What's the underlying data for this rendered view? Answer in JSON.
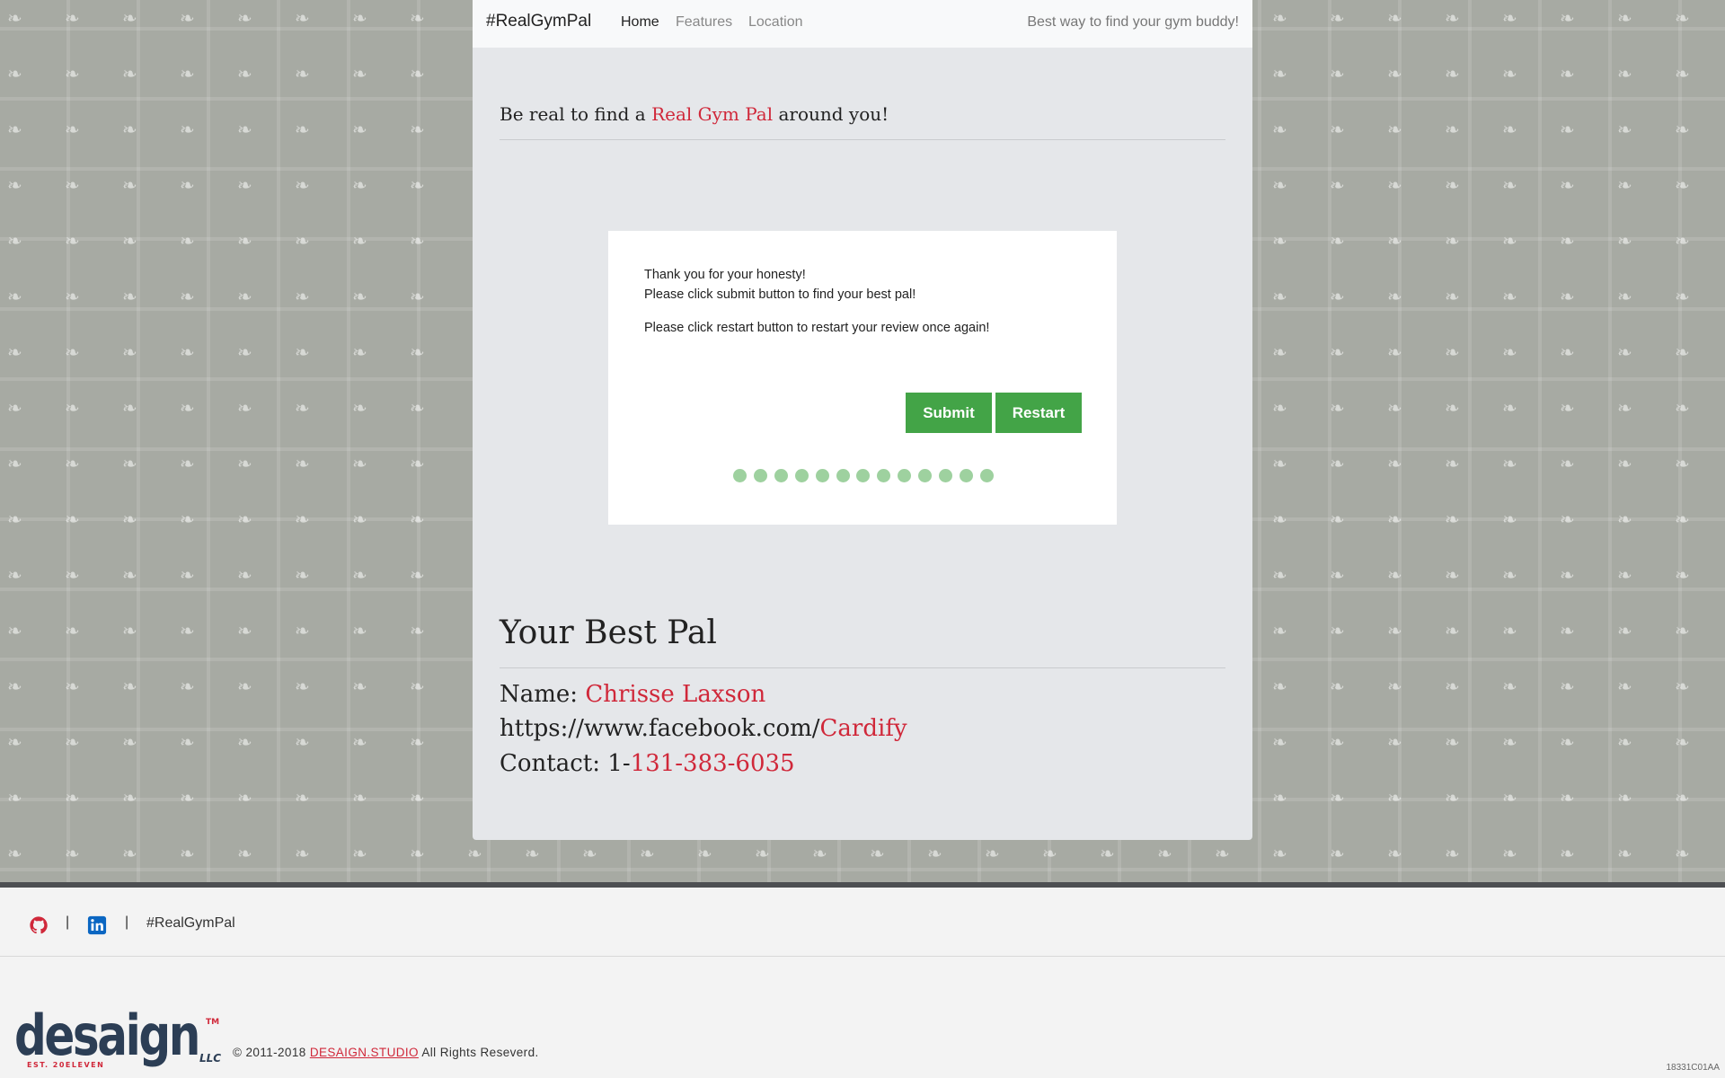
{
  "nav": {
    "brand": "#RealGymPal",
    "links": [
      "Home",
      "Features",
      "Location"
    ],
    "tagline": "Best way to find your gym buddy!"
  },
  "hero": {
    "prefix": "Be real to find a ",
    "highlight": "Real Gym Pal",
    "suffix": " around you!"
  },
  "card": {
    "line1": "Thank you for your honesty!",
    "line2": "Please click submit button to find your best pal!",
    "line3": "Please click restart button to restart your review once again!",
    "submit_label": "Submit",
    "restart_label": "Restart",
    "step_count": 13
  },
  "pal": {
    "heading": "Your Best Pal",
    "name_label": "Name: ",
    "name_value": "Chrisse Laxson",
    "fb_prefix": "https://www.facebook.com/",
    "fb_user": "Cardify",
    "contact_label": "Contact: 1-",
    "contact_value": "131-383-6035"
  },
  "footer": {
    "separator": "|",
    "hashtag": "#RealGymPal",
    "copyright_prefix": "© 2011-2018 ",
    "studio_link": "DESAIGN.STUDIO",
    "copyright_suffix": " All Rights Reseverd.",
    "logo_text": "desaign",
    "logo_tm": "TM",
    "logo_llc": "LLC",
    "logo_est": "EST. 20ELEVEN",
    "build_id": "18331C01AA",
    "icons": [
      "github-icon",
      "linkedin-icon"
    ]
  },
  "colors": {
    "accent": "#d0283a",
    "button": "#43a447",
    "dot": "#9ed19f",
    "page_bg": "#a7aaa3"
  }
}
